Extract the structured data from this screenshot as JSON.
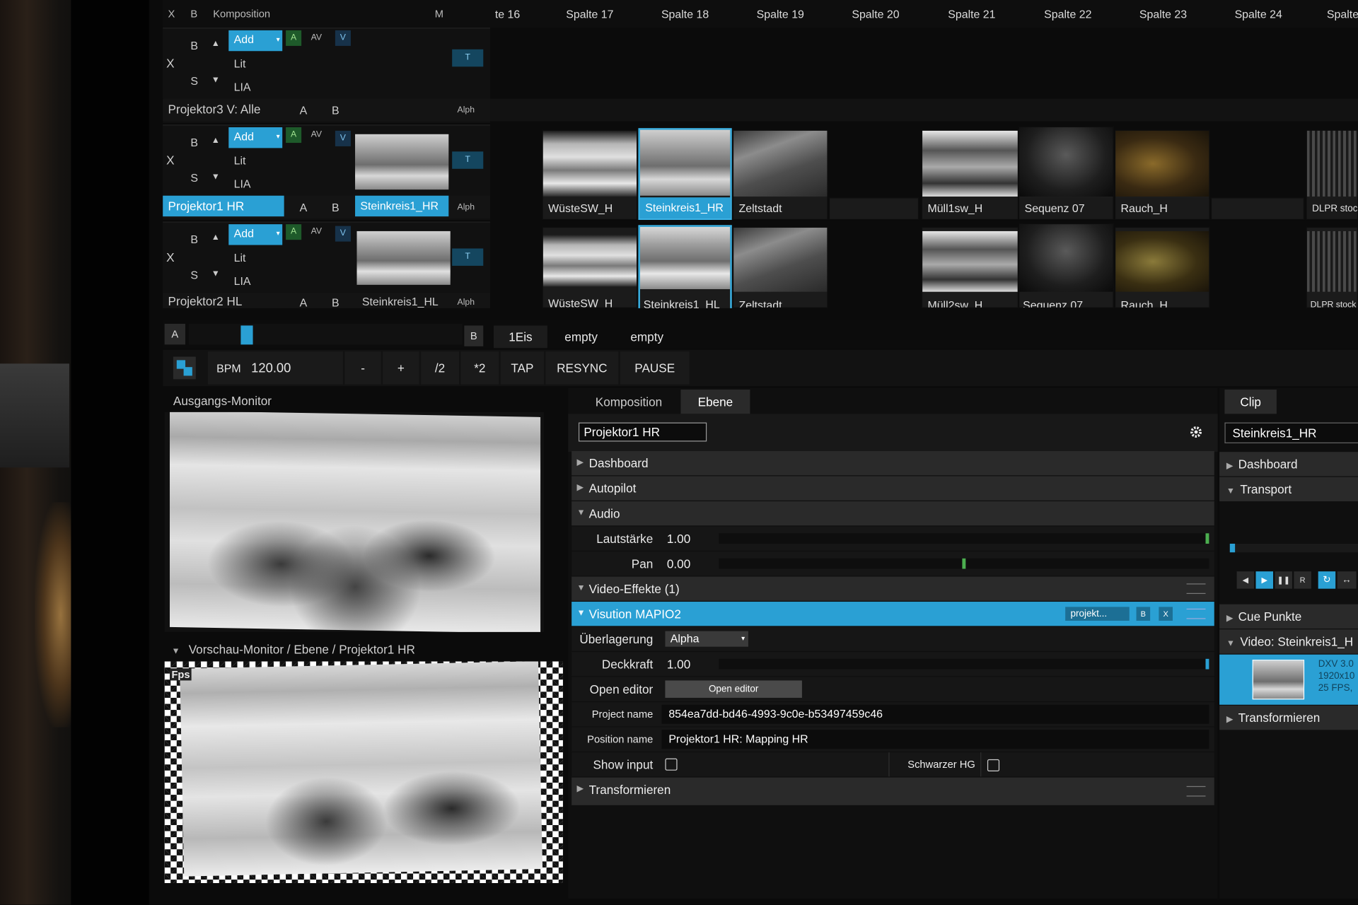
{
  "header": {
    "x": "X",
    "b": "B",
    "komposition": "Komposition",
    "m": "M",
    "columns": [
      "te 16",
      "Spalte 17",
      "Spalte 18",
      "Spalte 19",
      "Spalte 20",
      "Spalte 21",
      "Spalte 22",
      "Spalte 23",
      "Spalte 24",
      "Spalte"
    ]
  },
  "layers": [
    {
      "name": "Projektor3 V: Alle",
      "blend": "Add",
      "lit": "Lit",
      "lia": "LIA",
      "x": "X",
      "b": "B",
      "s": "S",
      "a": "A",
      "av": "AV",
      "v": "V",
      "t": "T",
      "ab_a": "A",
      "ab_b": "B",
      "alph": "Alph",
      "active_clip": "",
      "clips": []
    },
    {
      "name": "Projektor1 HR",
      "blend": "Add",
      "lit": "Lit",
      "lia": "LIA",
      "x": "X",
      "b": "B",
      "s": "S",
      "a": "A",
      "av": "AV",
      "v": "V",
      "t": "T",
      "ab_a": "A",
      "ab_b": "B",
      "alph": "Alph",
      "active_clip": "Steinkreis1_HR",
      "clips": [
        "WüsteSW_H",
        "Steinkreis1_HR",
        "Zeltstadt",
        "Müll1sw_H",
        "Sequenz 07",
        "Rauch_H",
        "DLPR stock"
      ]
    },
    {
      "name": "Projektor2 HL",
      "blend": "Add",
      "lit": "Lit",
      "lia": "LIA",
      "x": "X",
      "b": "B",
      "s": "S",
      "a": "A",
      "av": "AV",
      "v": "V",
      "t": "T",
      "ab_a": "A",
      "ab_b": "B",
      "alph": "Alph",
      "active_clip": "Steinkreis1_HL",
      "clips": [
        "WüsteSW_H",
        "Steinkreis1_HL",
        "Zeltstadt",
        "Müll2sw_H",
        "Sequenz 07",
        "Rauch_H",
        "DLPR stock"
      ]
    }
  ],
  "crossfader": {
    "a": "A",
    "b": "B",
    "position": 0.2,
    "decks": [
      "1Eis",
      "empty",
      "empty"
    ]
  },
  "transport": {
    "bpm_label": "BPM",
    "bpm_value": "120.00",
    "minus": "-",
    "plus": "+",
    "half": "/2",
    "double": "*2",
    "tap": "TAP",
    "resync": "RESYNC",
    "pause": "PAUSE"
  },
  "monitors": {
    "output": "Ausgangs-Monitor",
    "preview": "Vorschau-Monitor / Ebene / Projektor1 HR",
    "fps": "Fps"
  },
  "layer_panel": {
    "tabs": [
      "Komposition",
      "Ebene"
    ],
    "active_tab": "Ebene",
    "layer_name": "Projektor1 HR",
    "sections": {
      "dashboard": "Dashboard",
      "autopilot": "Autopilot",
      "audio": "Audio",
      "video_effects": "Video-Effekte (1)",
      "effect": "Visution MAPIO2",
      "transform": "Transformieren"
    },
    "audio": {
      "volume_label": "Lautstärke",
      "volume_value": "1.00",
      "volume_level": 1.0,
      "pan_label": "Pan",
      "pan_value": "0.00",
      "pan_level": 0.5
    },
    "effect": {
      "preset": "projekt...",
      "b": "B",
      "x": "X",
      "blend_label": "Überlagerung",
      "blend_value": "Alpha",
      "opacity_label": "Deckkraft",
      "opacity_value": "1.00",
      "opacity_level": 1.0,
      "open_editor_label": "Open editor",
      "open_editor_button": "Open editor",
      "project_name_label": "Project name",
      "project_name_value": "854ea7dd-bd46-4993-9c0e-b53497459c46",
      "position_name_label": "Position name",
      "position_name_value": "Projektor1 HR: Mapping HR",
      "show_input_label": "Show input",
      "black_bg_label": "Schwarzer HG"
    }
  },
  "clip_panel": {
    "tab": "Clip",
    "clip_name": "Steinkreis1_HR",
    "dashboard": "Dashboard",
    "transport": "Transport",
    "cue_points": "Cue Punkte",
    "video": "Video: Steinkreis1_H",
    "video_info": [
      "DXV 3.0",
      "1920x10",
      "25 FPS,"
    ],
    "transform": "Transformieren"
  },
  "colors": {
    "accent": "#2aa0d4",
    "green": "#4caf50",
    "background": "#0b0b0b"
  }
}
